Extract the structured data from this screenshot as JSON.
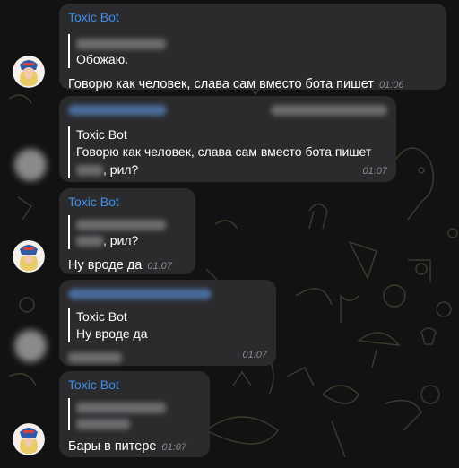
{
  "messages": [
    {
      "sender": "Toxic Bot",
      "quote_text": "Обожаю.",
      "text": "Говорю как человек, слава сам вместо бота пишет",
      "time": "01:06"
    },
    {
      "quote_sender": "Toxic Bot",
      "quote_text": "Говорю как человек, слава сам вместо бота пишет",
      "text_suffix": ", рил?",
      "time": "01:07"
    },
    {
      "sender": "Toxic Bot",
      "quote_suffix": ", рил?",
      "text": "Ну вроде да",
      "time": "01:07"
    },
    {
      "quote_sender": "Toxic Bot",
      "quote_text": "Ну вроде да",
      "time": "01:07"
    },
    {
      "sender": "Toxic Bot",
      "text": "Бары в питере",
      "time": "01:07"
    }
  ],
  "colors": {
    "background": "#121212",
    "bubble": "#2b2b2d",
    "sender_name": "#3f8ee8",
    "timestamp": "#8b8b8f"
  },
  "icons": [
    "bot-avatar-icon",
    "user-avatar-blurred"
  ]
}
